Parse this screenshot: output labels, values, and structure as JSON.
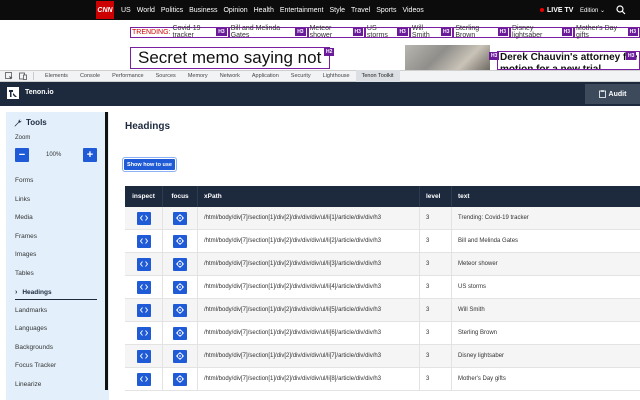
{
  "cnn": {
    "logo": "CNN",
    "nav": [
      "US",
      "World",
      "Politics",
      "Business",
      "Opinion",
      "Health",
      "Entertainment",
      "Style",
      "Travel",
      "Sports",
      "Videos"
    ],
    "live_tv": "LIVE TV",
    "edition": "Edition ⌄"
  },
  "trending": {
    "label": "TRENDING:",
    "items": [
      "Covid-19 tracker",
      "Bill and Melinda Gates",
      "Meteor shower",
      "US storms",
      "Will Smith",
      "Sterling Brown",
      "Disney lightsaber",
      "Mother's Day gifts"
    ],
    "tag": "H3"
  },
  "headlines": {
    "main": "Secret memo saying not",
    "main_tag": "H2",
    "photo_tag": "H3",
    "side": "Derek Chauvin's attorney file motion for a new trial",
    "side_tag": "H3"
  },
  "devtools": {
    "tabs": [
      "Elements",
      "Console",
      "Performance",
      "Sources",
      "Memory",
      "Network",
      "Application",
      "Security",
      "Lighthouse",
      "Tenon Toolkit"
    ],
    "active_tab": "Tenon Toolkit"
  },
  "tenon": {
    "title": "Tenon.io",
    "audit_label": "Audit"
  },
  "sidebar": {
    "tools_label": "Tools",
    "zoom_label": "Zoom",
    "zoom_value": "100%",
    "items": [
      "Forms",
      "Links",
      "Media",
      "Frames",
      "Images",
      "Tables",
      "Headings",
      "Landmarks",
      "Languages",
      "Backgrounds",
      "Focus Tracker",
      "Linearize"
    ],
    "active_item": "Headings"
  },
  "main": {
    "title": "Headings",
    "show_button": "Show how to use",
    "columns": [
      "inspect",
      "focus",
      "xPath",
      "level",
      "text"
    ],
    "rows": [
      {
        "xpath": "/html/body/div[7]/section[1]/div[2]/div/div/div/ul/li[1]/article/div/div/h3",
        "level": "3",
        "text": "Trending: Covid-19 tracker"
      },
      {
        "xpath": "/html/body/div[7]/section[1]/div[2]/div/div/div/ul/li[2]/article/div/div/h3",
        "level": "3",
        "text": "Bill and Melinda Gates"
      },
      {
        "xpath": "/html/body/div[7]/section[1]/div[2]/div/div/div/ul/li[3]/article/div/div/h3",
        "level": "3",
        "text": "Meteor shower"
      },
      {
        "xpath": "/html/body/div[7]/section[1]/div[2]/div/div/div/ul/li[4]/article/div/div/h3",
        "level": "3",
        "text": "US storms"
      },
      {
        "xpath": "/html/body/div[7]/section[1]/div[2]/div/div/div/ul/li[5]/article/div/div/h3",
        "level": "3",
        "text": "Will Smith"
      },
      {
        "xpath": "/html/body/div[7]/section[1]/div[2]/div/div/div/ul/li[6]/article/div/div/h3",
        "level": "3",
        "text": "Sterling Brown"
      },
      {
        "xpath": "/html/body/div[7]/section[1]/div[2]/div/div/div/ul/li[7]/article/div/div/h3",
        "level": "3",
        "text": "Disney lightsaber"
      },
      {
        "xpath": "/html/body/div[7]/section[1]/div[2]/div/div/div/ul/li[8]/article/div/div/h3",
        "level": "3",
        "text": "Mother's Day gifts"
      }
    ]
  },
  "colors": {
    "navy": "#1d2a3e",
    "blue": "#1f5bd6",
    "sidebar_bg": "#e3f0fb",
    "heading_outline": "#7b1fa2",
    "cnn_red": "#cc0000"
  }
}
